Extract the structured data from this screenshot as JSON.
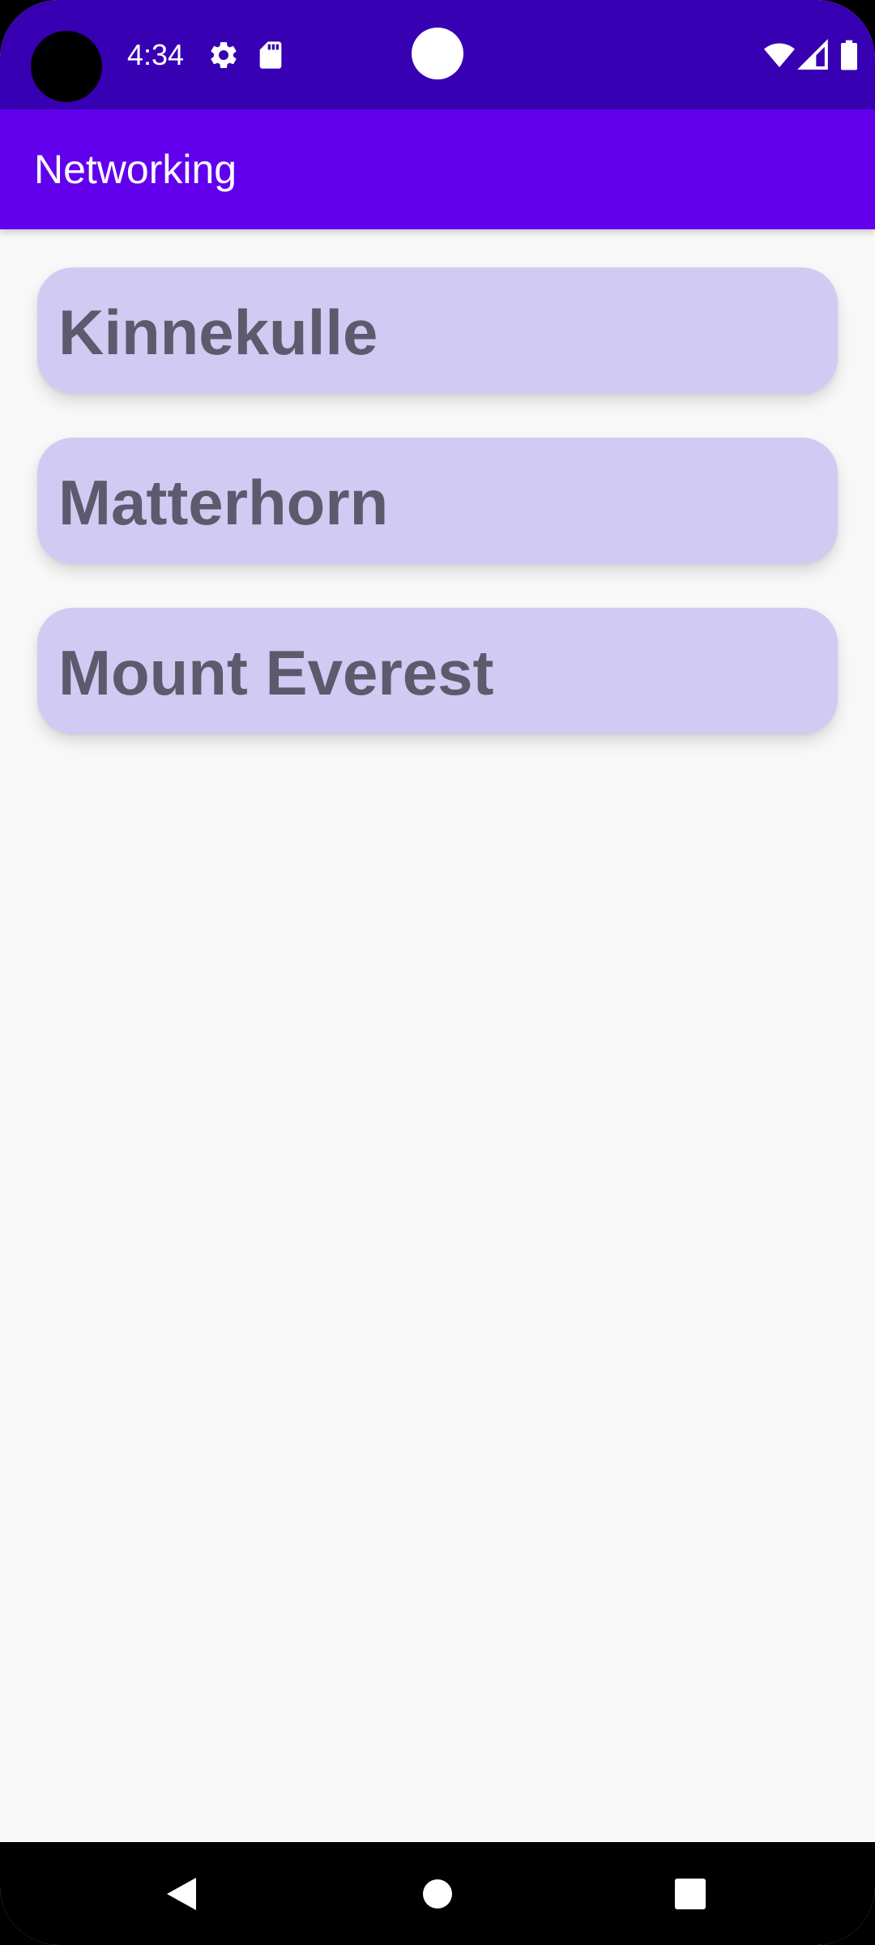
{
  "status_bar": {
    "time": "4:34",
    "icons": [
      "settings-icon",
      "sd-card-icon",
      "wifi-icon",
      "cell-signal-icon",
      "battery-icon"
    ]
  },
  "app_bar": {
    "title": "Networking",
    "color": "#6200ee"
  },
  "mountains": {
    "items": [
      {
        "label": "Kinnekulle"
      },
      {
        "label": "Matterhorn"
      },
      {
        "label": "Mount Everest"
      }
    ]
  },
  "nav_bar": {
    "buttons": [
      "back-icon",
      "home-icon",
      "recents-icon"
    ]
  },
  "colors": {
    "status_bar": "#3700b3",
    "card_background": "#d1cbf3",
    "card_text": "#5c5a6c",
    "page_background": "#f8f8f8"
  }
}
